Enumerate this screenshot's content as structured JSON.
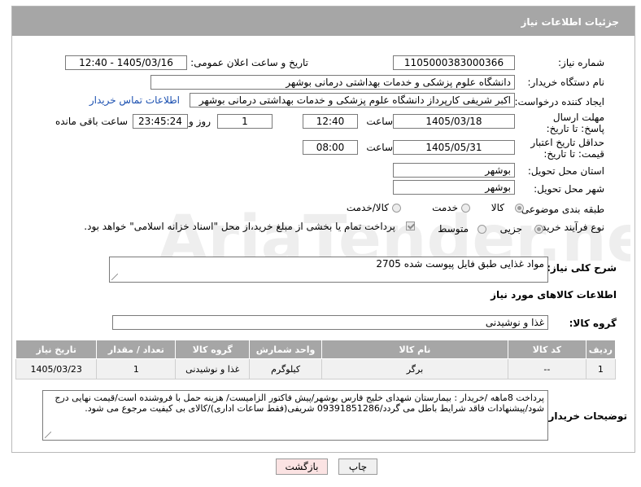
{
  "panel": {
    "title": "جزئیات اطلاعات نیاز"
  },
  "fields": {
    "need_number_label": "شماره نیاز:",
    "need_number": "1105000383000366",
    "announce_label": "تاریخ و ساعت اعلان عمومی:",
    "announce_value": "1405/03/16 - 12:40",
    "buyer_org_label": "نام دستگاه خریدار:",
    "buyer_org": "دانشگاه علوم پزشکی و خدمات بهداشتی درمانی بوشهر",
    "requester_label": "ایجاد کننده درخواست:",
    "requester": "اکبر شریفی کارپرداز دانشگاه علوم پزشکی و خدمات بهداشتی درمانی بوشهر",
    "contact_link": "اطلاعات تماس خریدار",
    "reply_deadline_label": "مهلت ارسال پاسخ: تا تاریخ:",
    "reply_date": "1405/03/18",
    "time_label": "ساعت",
    "reply_time": "12:40",
    "days_value": "1",
    "days_label": "روز و",
    "remaining_time": "23:45:24",
    "remaining_label": "ساعت باقی مانده",
    "price_validity_label": "حداقل تاریخ اعتبار قیمت: تا تاریخ:",
    "price_date": "1405/05/31",
    "price_time": "08:00",
    "province_label": "استان محل تحویل:",
    "province": "بوشهر",
    "city_label": "شهر محل تحویل:",
    "city": "بوشهر",
    "category_label": "طبقه بندی موضوعی:",
    "category_options": [
      "کالا",
      "خدمت",
      "کالا/خدمت"
    ],
    "process_label": "نوع فرآیند خرید :",
    "process_options": [
      "جزیی",
      "متوسط"
    ],
    "payment_note": "پرداخت تمام یا بخشی از مبلغ خرید،از محل \"اسناد خزانه اسلامی\" خواهد بود.",
    "description_label": "شرح کلی نیاز:",
    "description": "مواد غذایی طبق فایل پیوست شده 2705"
  },
  "goods": {
    "section_title": "اطلاعات کالاهای مورد نیاز",
    "group_label": "گروه کالا:",
    "group_value": "غذا و نوشیدنی",
    "columns": [
      "ردیف",
      "کد کالا",
      "نام کالا",
      "واحد شمارش",
      "گروه کالا",
      "تعداد / مقدار",
      "تاریخ نیاز"
    ],
    "rows": [
      [
        "1",
        "--",
        "برگر",
        "کیلوگرم",
        "غذا و نوشیدنی",
        "1",
        "1405/03/23"
      ]
    ]
  },
  "buyer_notes": {
    "label": "توضیحات خریدار:",
    "text": "پرداخت 8ماهه /خریدار : بیمارستان شهدای خلیج فارس بوشهر/پیش فاکتور الزامیست/ هزینه حمل با فروشنده است/قیمت نهایی درج شود/پیشنهادات فاقد شرایط باطل می گردد/09391851286 شریفی(فقط ساعات اداری)/کالای بی کیفیت مرجوع می شود."
  },
  "buttons": {
    "print": "چاپ",
    "back": "بازگشت"
  },
  "colors": {
    "header_bg": "#a6a6a6",
    "link": "#1a4fb0",
    "back_button_bg": "#fbe3e3"
  }
}
